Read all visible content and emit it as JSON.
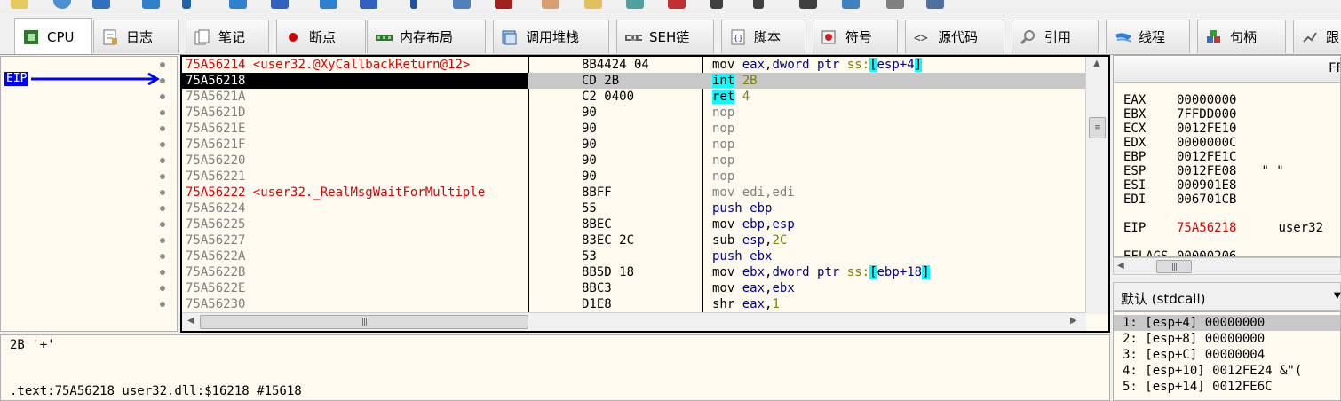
{
  "tabs": [
    {
      "label": "CPU",
      "icon": "cpu-icon"
    },
    {
      "label": "日志",
      "icon": "log-icon"
    },
    {
      "label": "笔记",
      "icon": "notes-icon"
    },
    {
      "label": "断点",
      "icon": "breakpoint-icon"
    },
    {
      "label": "内存布局",
      "icon": "memory-map-icon"
    },
    {
      "label": "调用堆栈",
      "icon": "call-stack-icon"
    },
    {
      "label": "SEH链",
      "icon": "seh-chain-icon"
    },
    {
      "label": "脚本",
      "icon": "script-icon"
    },
    {
      "label": "符号",
      "icon": "symbols-icon"
    },
    {
      "label": "源代码",
      "icon": "source-icon"
    },
    {
      "label": "引用",
      "icon": "references-icon"
    },
    {
      "label": "线程",
      "icon": "threads-icon"
    },
    {
      "label": "句柄",
      "icon": "handles-icon"
    },
    {
      "label": "跟",
      "icon": "trace-icon"
    }
  ],
  "gutter": {
    "eip_label": "EIP"
  },
  "disasm": {
    "rows": [
      {
        "addr": "75A56214",
        "label": "<user32.@XyCallbackReturn@12>",
        "bytes": "8B4424 04"
      },
      {
        "addr": "75A56218",
        "label": "",
        "bytes": "CD 2B"
      },
      {
        "addr": "75A5621A",
        "label": "",
        "bytes": "C2 0400"
      },
      {
        "addr": "75A5621D",
        "label": "",
        "bytes": "90"
      },
      {
        "addr": "75A5621E",
        "label": "",
        "bytes": "90"
      },
      {
        "addr": "75A5621F",
        "label": "",
        "bytes": "90"
      },
      {
        "addr": "75A56220",
        "label": "",
        "bytes": "90"
      },
      {
        "addr": "75A56221",
        "label": "",
        "bytes": "90"
      },
      {
        "addr": "75A56222",
        "label": "<user32._RealMsgWaitForMultiple",
        "bytes": "8BFF"
      },
      {
        "addr": "75A56224",
        "label": "",
        "bytes": "55"
      },
      {
        "addr": "75A56225",
        "label": "",
        "bytes": "8BEC"
      },
      {
        "addr": "75A56227",
        "label": "",
        "bytes": "83EC 2C"
      },
      {
        "addr": "75A5622A",
        "label": "",
        "bytes": "53"
      },
      {
        "addr": "75A5622B",
        "label": "",
        "bytes": "8B5D 18"
      },
      {
        "addr": "75A5622E",
        "label": "",
        "bytes": "8BC3"
      },
      {
        "addr": "75A56230",
        "label": "",
        "bytes": "D1E8"
      }
    ],
    "ins": {
      "r0": {
        "m": "mov",
        "a": "eax",
        "c": ",",
        "b": "dword ptr",
        "s": "ss:",
        "lb": "[",
        "x": "esp+4",
        "rb": "]"
      },
      "r1": {
        "m": "int",
        "a": "2B"
      },
      "r2": {
        "m": "ret",
        "a": "4"
      },
      "nop": "nop",
      "r8": {
        "m": "mov",
        "a": "edi,edi"
      },
      "r9": {
        "m": "push",
        "a": "ebp"
      },
      "r10": {
        "m": "mov",
        "a": "ebp",
        "c": ",",
        "b": "esp"
      },
      "r11": {
        "m": "sub",
        "a": "esp",
        "c": ",",
        "b": "2C"
      },
      "r12": {
        "m": "push",
        "a": "ebx"
      },
      "r13": {
        "m": "mov",
        "a": "ebx",
        "c": ",",
        "b": "dword ptr",
        "s": "ss:",
        "lb": "[",
        "x": "ebp+18",
        "rb": "]"
      },
      "r14": {
        "m": "mov",
        "a": "eax",
        "c": ",",
        "b": "ebx"
      },
      "r15": {
        "m": "shr",
        "a": "eax",
        "c": ",",
        "b": "1"
      }
    }
  },
  "info": {
    "line1": "2B '+'",
    "line2": ".text:75A56218 user32.dll:$16218 #15618"
  },
  "registers": {
    "header": "FF",
    "items": [
      {
        "name": "EAX",
        "value": "00000000",
        "extra": ""
      },
      {
        "name": "EBX",
        "value": "7FFDD000",
        "extra": ""
      },
      {
        "name": "ECX",
        "value": "0012FE10",
        "extra": ""
      },
      {
        "name": "EDX",
        "value": "0000000C",
        "extra": ""
      },
      {
        "name": "EBP",
        "value": "0012FE1C",
        "extra": ""
      },
      {
        "name": "ESP",
        "value": "0012FE08",
        "extra": "\"    \""
      },
      {
        "name": "ESI",
        "value": "000901E8",
        "extra": ""
      },
      {
        "name": "EDI",
        "value": "006701CB",
        "extra": ""
      }
    ],
    "eip": {
      "name": "EIP",
      "value": "75A56218",
      "extra": "user32"
    },
    "eflags": {
      "name": "EFLAGS",
      "value": "00000206"
    }
  },
  "calling_convention": {
    "label": "默认 (stdcall)"
  },
  "stack": [
    "1: [esp+4] 00000000",
    "2: [esp+8] 00000000",
    "3: [esp+C] 00000004",
    "4: [esp+10] 0012FE24 &\"(",
    "5: [esp+14] 0012FE6C"
  ]
}
